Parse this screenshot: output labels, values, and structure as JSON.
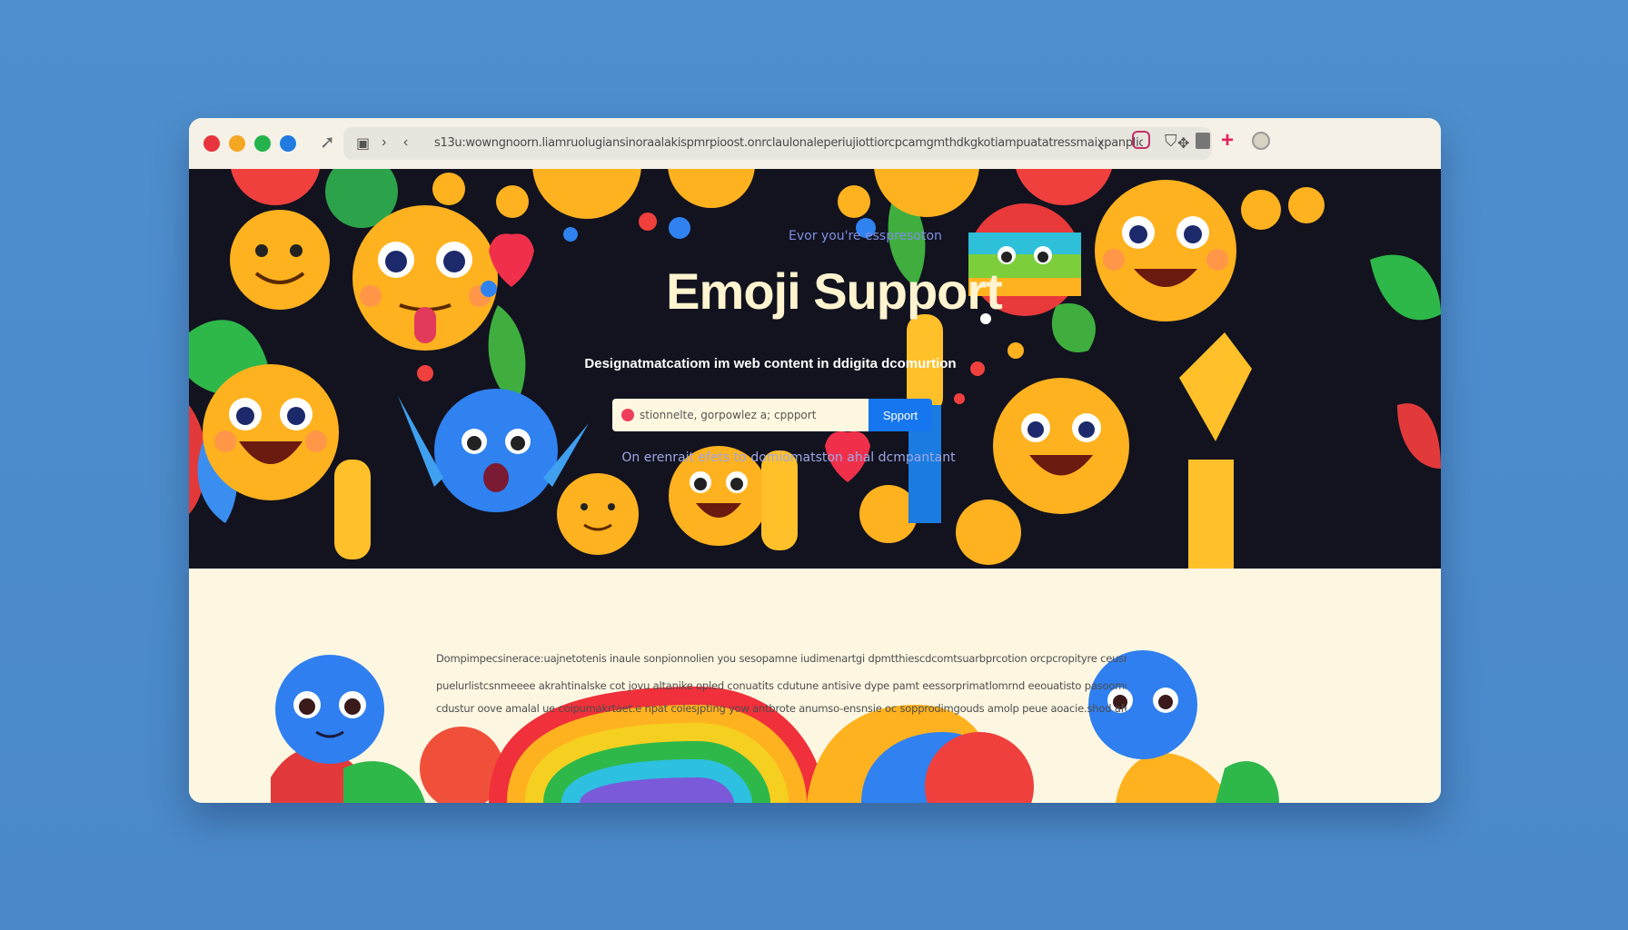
{
  "browser": {
    "url": "s13u:wowngnoorn.liamruolugiansinoraalakispmrpioost.onrclaulonaleperiujiottiorcpcamgmthdkgkotiampuatatressmaixpanpliciechctol /",
    "window_dot_colors": [
      "#e8343f",
      "#f5a623",
      "#24b34b",
      "#1f7be0"
    ],
    "toolbar_icons": [
      "back-icon",
      "extensions-icon",
      "shield-icon",
      "bookmark-icon",
      "plus-icon",
      "profile-icon"
    ]
  },
  "hero": {
    "tagline": "Evor you're esspresoton",
    "title": "Emoji Support",
    "subtitle": "Designatmatcatiom im web content in ddigita dcomurtion",
    "search": {
      "value": "stionnelte, gorpowlez a; cppport",
      "button_label": "Spport"
    },
    "note": "On erenrait efets to domiomatston ahal dcmpantant"
  },
  "content": {
    "paragraphs": [
      "Dompimpecsinerace:uajnetotenis inaule sonpionnolien  you sesopamne iudimenartgi dpmtthiescdcomtsuarbprcotion orcpcropityre ceusrarmirnrics,",
      "puelurlistcsnmeeee akrahtinalske cot jovu altanike opled conuatits cdutune antisive dype pamt eessorprimatlomrnd eeouatisto pasoommantion,",
      "cdustur oove amalal ue coipumakrtaet.e npat colesjpting yow antbrote anumso-ensnsie oc sopprodimgouds amolp peue aoacie.shod afetunp."
    ]
  },
  "colors": {
    "hero_background": "#12131f",
    "accent_button": "#1576f0",
    "title": "#fff4cf",
    "page_background": "#4f8fce"
  }
}
